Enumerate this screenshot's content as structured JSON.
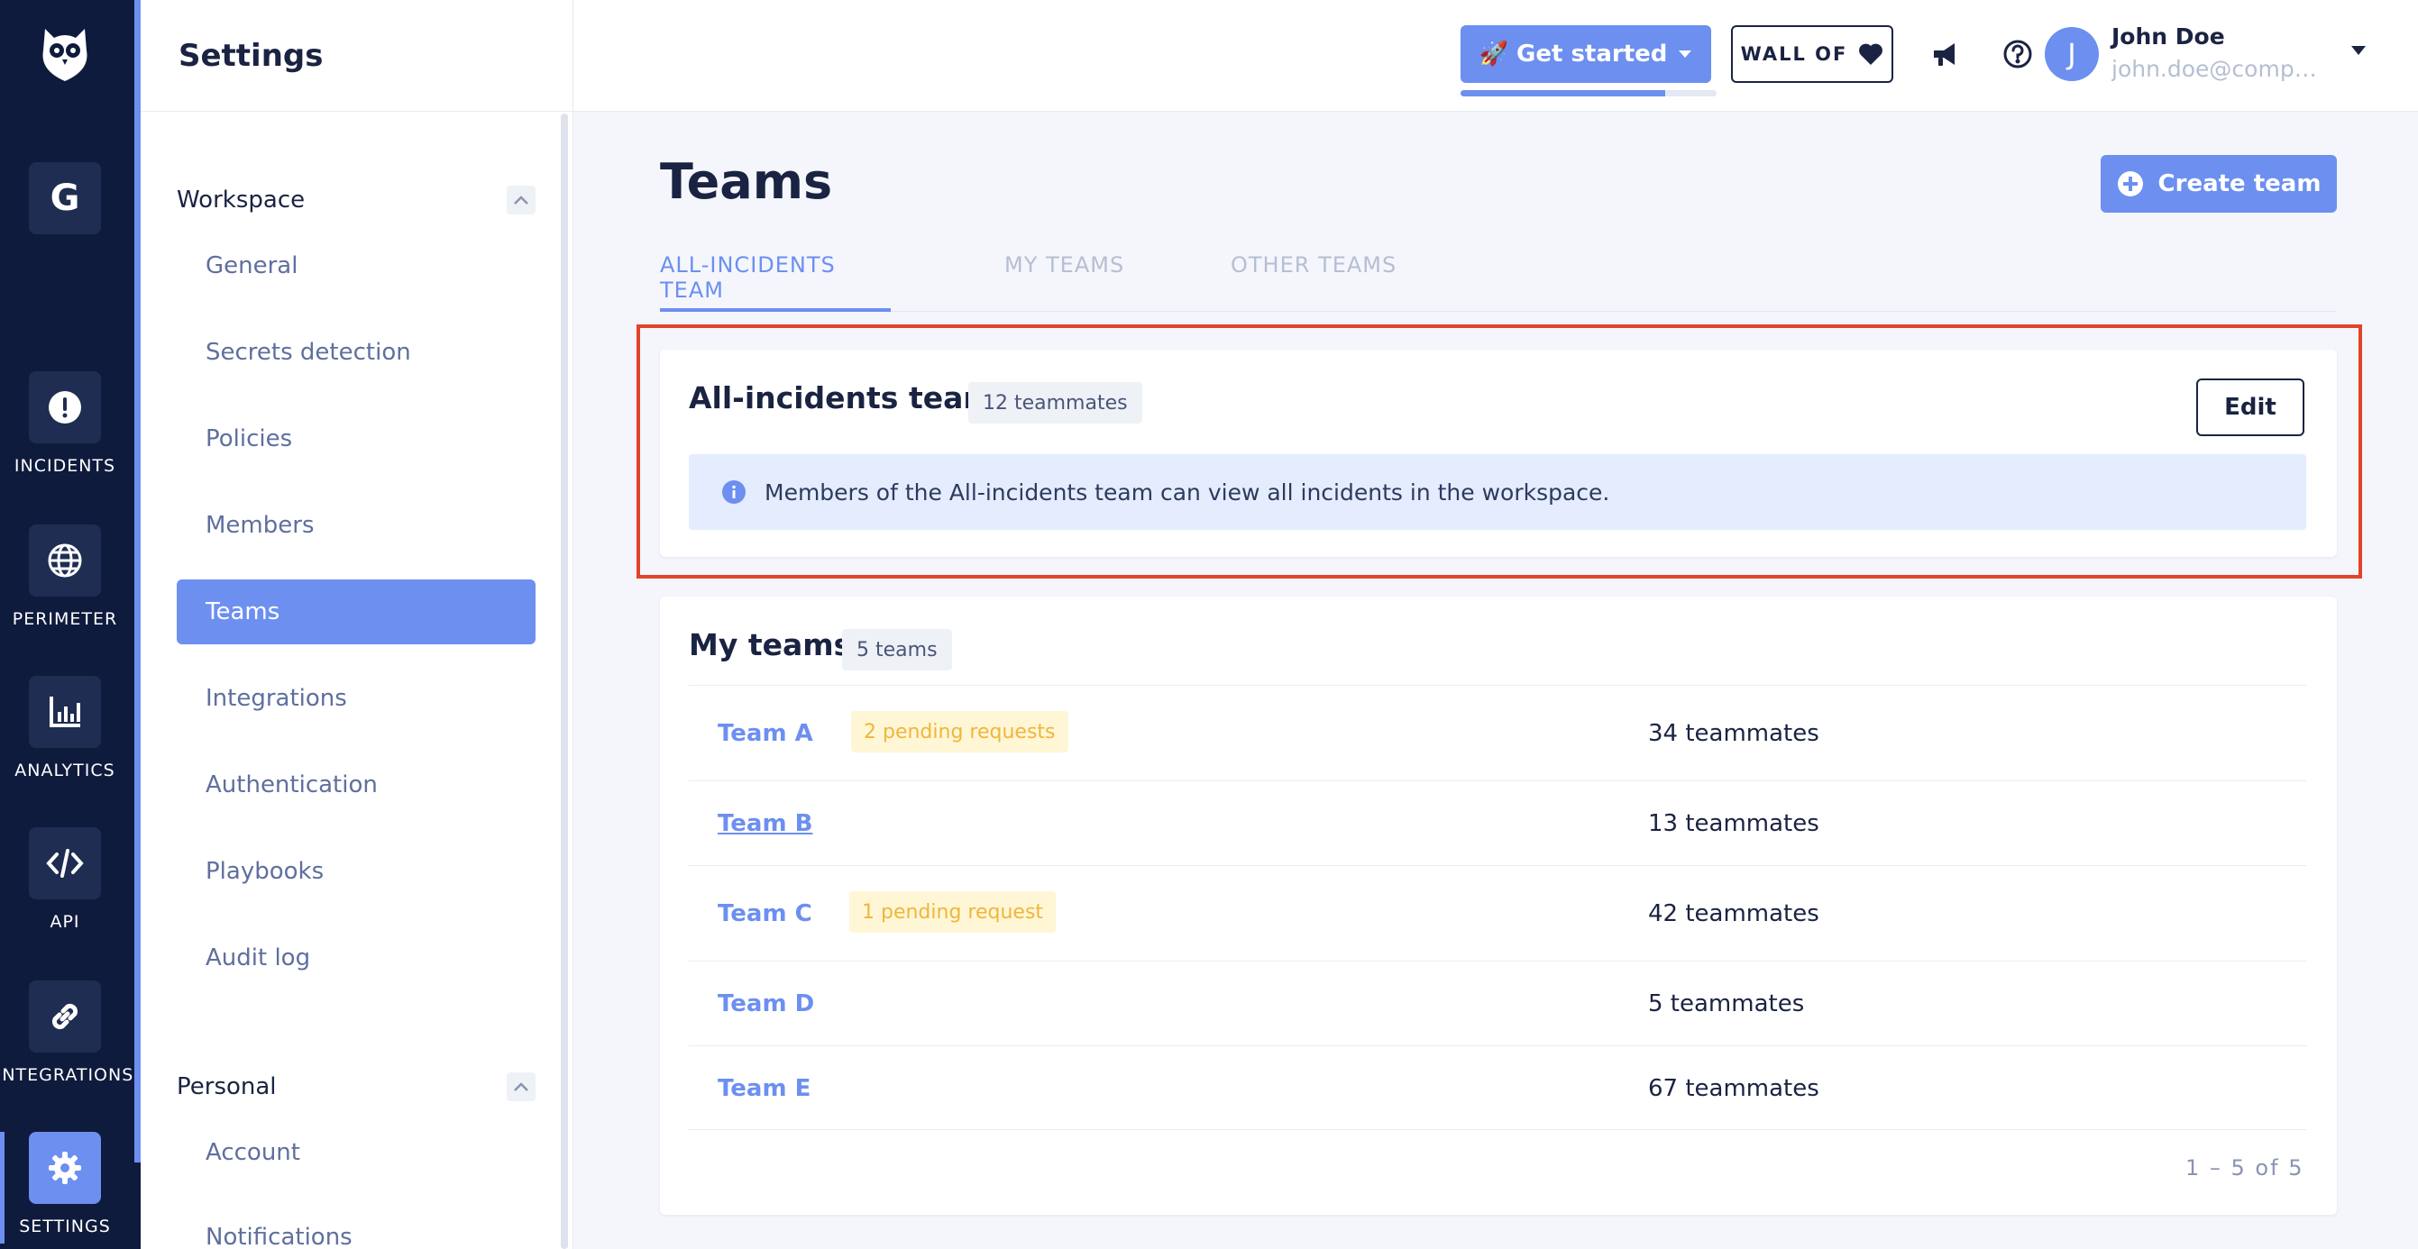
{
  "rail": {
    "workspace_initial": "G",
    "items": [
      {
        "label": "INCIDENTS",
        "icon": "alert-icon"
      },
      {
        "label": "PERIMETER",
        "icon": "globe-icon"
      },
      {
        "label": "ANALYTICS",
        "icon": "chart-icon"
      },
      {
        "label": "API",
        "icon": "code-icon"
      },
      {
        "label": "INTEGRATIONS",
        "icon": "link-icon"
      },
      {
        "label": "SETTINGS",
        "icon": "gear-icon",
        "active": true
      }
    ]
  },
  "sidebar": {
    "title": "Settings",
    "workspace_group": "Workspace",
    "workspace_items": [
      "General",
      "Secrets detection",
      "Policies",
      "Members",
      "Teams",
      "Integrations",
      "Authentication",
      "Playbooks",
      "Audit log"
    ],
    "active_item": "Teams",
    "personal_group": "Personal",
    "personal_items": [
      "Account",
      "Notifications"
    ]
  },
  "header": {
    "get_started": "🚀 Get started",
    "onboarding_progress": 0.8,
    "wall_of": "WALL OF",
    "user_initial": "J",
    "user_name": "John Doe",
    "user_email": "john.doe@compa..."
  },
  "main": {
    "title": "Teams",
    "create_team": "Create team",
    "tabs": [
      "ALL-INCIDENTS TEAM",
      "MY TEAMS",
      "OTHER TEAMS"
    ],
    "active_tab": "ALL-INCIDENTS TEAM",
    "all_incidents": {
      "title": "All-incidents team",
      "badge": "12 teammates",
      "edit": "Edit",
      "info": "Members of the All-incidents team can view all incidents in the workspace."
    },
    "my_teams": {
      "title": "My teams",
      "badge": "5 teams",
      "rows": [
        {
          "name": "Team A",
          "pending": "2 pending requests",
          "count": "34 teammates"
        },
        {
          "name": "Team B",
          "pending": "",
          "count": "13 teammates"
        },
        {
          "name": "Team C",
          "pending": "1 pending request",
          "count": "42 teammates"
        },
        {
          "name": "Team D",
          "pending": "",
          "count": "5 teammates"
        },
        {
          "name": "Team E",
          "pending": "",
          "count": "67 teammates"
        }
      ],
      "pagination": "1 – 5  of  5"
    }
  },
  "colors": {
    "accent": "#6c8ff0",
    "rail_bg": "#0f1b3d",
    "highlight": "#e2432a",
    "pending_text": "#f0b63a"
  }
}
